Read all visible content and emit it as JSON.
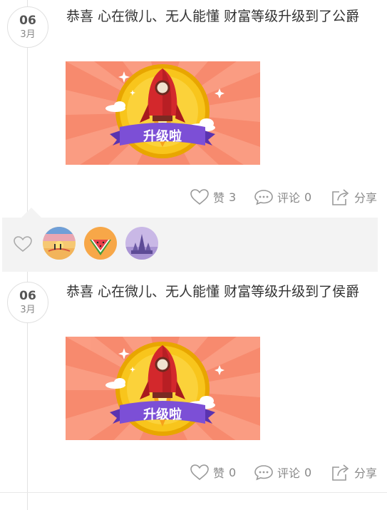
{
  "posts": [
    {
      "day": "06",
      "month": "3月",
      "text": "恭喜 心在微儿、无人能懂 财富等级升级到了公爵",
      "image": {
        "banner_text": "升级啦",
        "colors": {
          "background": "#f78a6e",
          "ray": "#fba58c",
          "gold": "#f8c01c",
          "rocket": "#d3282c",
          "ribbon": "#7c4fd6"
        }
      },
      "like": {
        "icon": "heart-outline-icon",
        "label": "赞",
        "count": "3"
      },
      "comment": {
        "icon": "comment-bubble-icon",
        "label": "评论",
        "count": "0"
      },
      "share": {
        "icon": "share-arrow-icon",
        "label": "分享"
      }
    },
    {
      "day": "06",
      "month": "3月",
      "text": "恭喜 心在微儿、无人能懂 财富等级升级到了侯爵",
      "image": {
        "banner_text": "升级啦"
      },
      "like": {
        "icon": "heart-outline-icon",
        "label": "赞",
        "count": "0"
      },
      "comment": {
        "icon": "comment-bubble-icon",
        "label": "评论",
        "count": "0"
      },
      "share": {
        "icon": "share-arrow-icon",
        "label": "分享"
      }
    }
  ],
  "likes_bar": {
    "icon": "heart-outline-icon",
    "avatars": [
      {
        "name": "avatar-sunset-beach"
      },
      {
        "name": "avatar-watermelon"
      },
      {
        "name": "avatar-purple-castle"
      }
    ]
  }
}
